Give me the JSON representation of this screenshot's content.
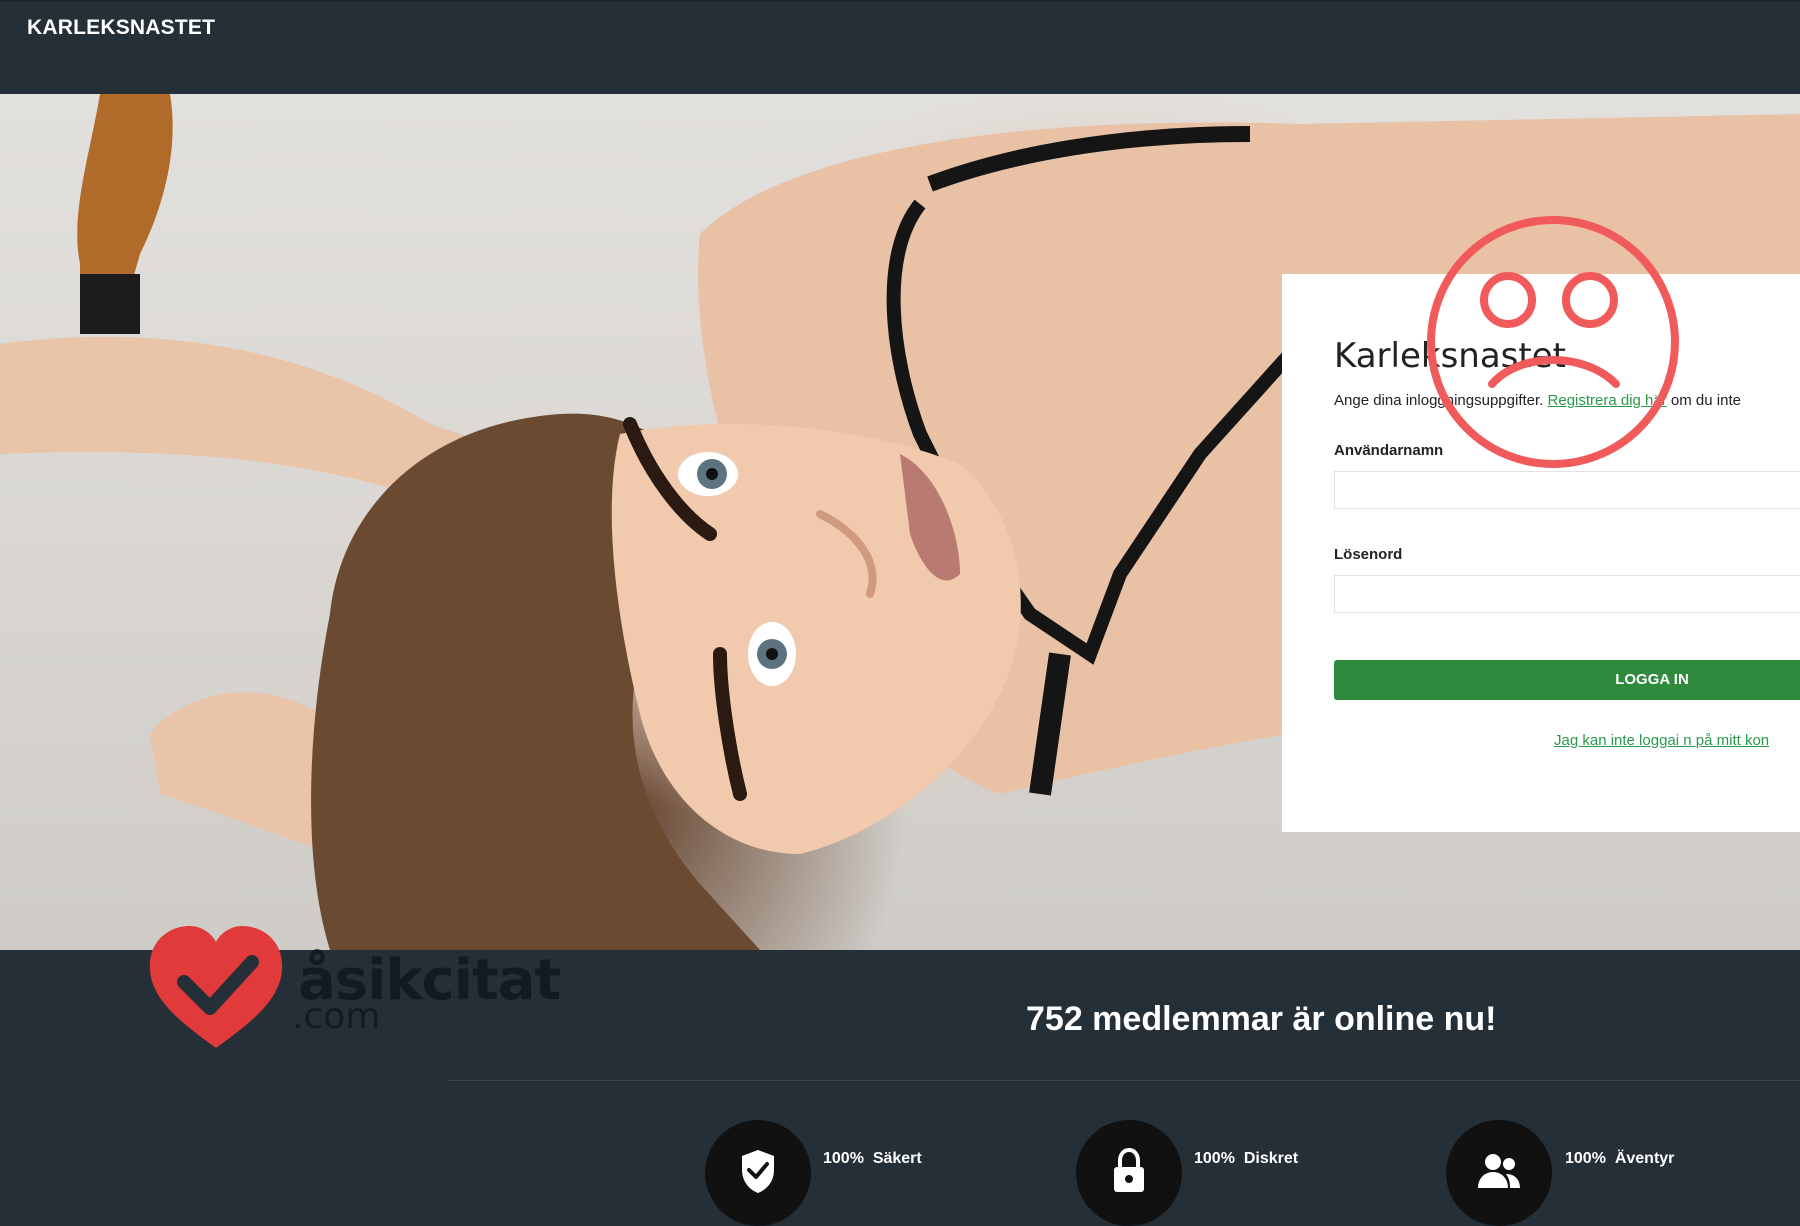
{
  "header": {
    "brand": "KARLEKSNASTET"
  },
  "login": {
    "title": "Karleksnastet",
    "intro_prefix": "Ange dina inloggningsuppgifter. ",
    "register_link": "Registrera dig här",
    "intro_suffix": " om du inte",
    "username_label": "Användarnamn",
    "username_value": "",
    "password_label": "Lösenord",
    "password_value": "",
    "submit_label": "LOGGA IN",
    "forgot_link": "Jag kan inte loggai n på mitt kon"
  },
  "watermark": {
    "name": "åsikcitat",
    "domain": ".com"
  },
  "stats": {
    "online_text": "752 medlemmar är online nu!"
  },
  "features": [
    {
      "percent": "100%",
      "label": "Säkert",
      "icon": "shield-check-icon"
    },
    {
      "percent": "100%",
      "label": "Diskret",
      "icon": "lock-icon"
    },
    {
      "percent": "100%",
      "label": "Äventyr",
      "icon": "users-icon"
    }
  ],
  "colors": {
    "background": "#242f38",
    "accent_green": "#2e8b3d",
    "link_green": "#2a9a4a",
    "sad_face_red": "#f05a5a",
    "heart_red": "#e03a3a"
  }
}
